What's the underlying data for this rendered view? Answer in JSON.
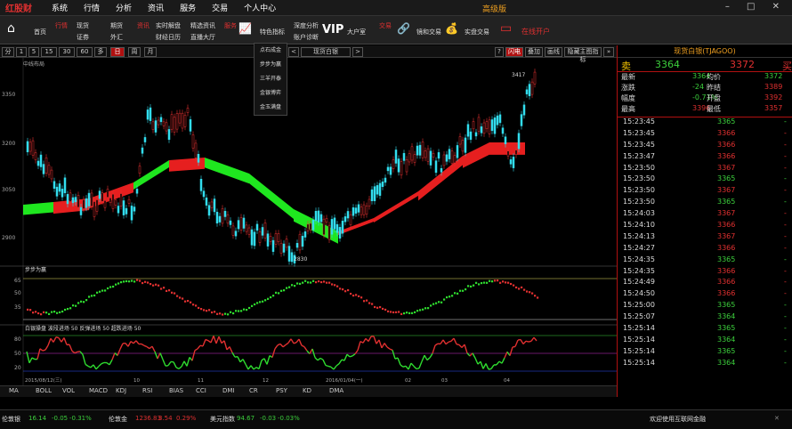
{
  "app": {
    "logo": "红股财",
    "title": "高级版"
  },
  "menu": [
    "系统",
    "行情",
    "分析",
    "资讯",
    "服务",
    "交易",
    "个人中心"
  ],
  "toolbar": {
    "home": "首页",
    "quote_btns": [
      "现货",
      "期货",
      "实时解盘",
      "精选资讯",
      "证券",
      "外汇",
      "财经日历",
      "直播大厅"
    ],
    "special": "特色指标",
    "deep": "深度分析",
    "account": "账户诊断",
    "vip": "VIP",
    "big": "大户室",
    "link": "镜和交易",
    "real": "实盘交易",
    "open": "在线开户",
    "left_tags": [
      "行情",
      "资讯",
      "服务",
      "交易"
    ]
  },
  "dropdown": [
    "点石成金",
    "步步为赢",
    "三羊开泰",
    "金银博弈",
    "金玉满盘"
  ],
  "tabs": {
    "periods": [
      "分",
      "1",
      "5",
      "15",
      "30",
      "60",
      "多",
      "日",
      "周",
      "月"
    ],
    "active": "日",
    "symbol": "现货白银",
    "right": [
      "?",
      "闪电",
      "叠加",
      "画线",
      "隐藏主图指标"
    ]
  },
  "chart": {
    "title": "中线布局",
    "ylabels": [
      "3350",
      "3200",
      "3050",
      "2900"
    ],
    "high_label": "3417",
    "low_label": "2830",
    "ind1_title": "步步为赢",
    "ind1_ylabels": [
      "65",
      "50",
      "35"
    ],
    "ind2_title": "白银操盘 波段进场 50 反弹进场 50 超跌进场 50",
    "ind2_ylabels": [
      "80",
      "50",
      "20"
    ],
    "xlabels": [
      "2015/08/12(三)",
      "10",
      "11",
      "12",
      "2016/01/04(一)",
      "02",
      "03",
      "04"
    ]
  },
  "indicators": [
    "MA",
    "BOLL",
    "VOL",
    "MACD",
    "KDJ",
    "RSI",
    "BIAS",
    "CCI",
    "DMI",
    "CR",
    "PSY",
    "KD",
    "DMA"
  ],
  "side": {
    "title": "现货白银(TJAGOO)",
    "sell_label": "卖",
    "sell_price": "3364",
    "buy_price": "3372",
    "buy_label": "买",
    "stats": [
      [
        "最新",
        "3364",
        "均价",
        "3372"
      ],
      [
        "涨跌",
        "-24",
        "昨结",
        "3389"
      ],
      [
        "幅度",
        "-0.71%",
        "开盘",
        "3392"
      ],
      [
        "最高",
        "3396",
        "最低",
        "3357"
      ]
    ],
    "trades": [
      [
        "15:23:45",
        "3365",
        "-"
      ],
      [
        "15:23:45",
        "3366",
        "-"
      ],
      [
        "15:23:45",
        "3366",
        "-"
      ],
      [
        "15:23:47",
        "3366",
        "-"
      ],
      [
        "15:23:50",
        "3367",
        "-"
      ],
      [
        "15:23:50",
        "3365",
        "-"
      ],
      [
        "15:23:50",
        "3367",
        "-"
      ],
      [
        "15:23:50",
        "3365",
        "-"
      ],
      [
        "15:24:03",
        "3367",
        "-"
      ],
      [
        "15:24:10",
        "3366",
        "-"
      ],
      [
        "15:24:13",
        "3367",
        "-"
      ],
      [
        "15:24:27",
        "3366",
        "-"
      ],
      [
        "15:24:35",
        "3365",
        "-"
      ],
      [
        "15:24:35",
        "3366",
        "-"
      ],
      [
        "15:24:49",
        "3366",
        "-"
      ],
      [
        "15:24:50",
        "3366",
        "-"
      ],
      [
        "15:25:00",
        "3365",
        "-"
      ],
      [
        "15:25:07",
        "3364",
        "-"
      ],
      [
        "15:25:14",
        "3365",
        "-"
      ],
      [
        "15:25:14",
        "3364",
        "-"
      ],
      [
        "15:25:14",
        "3365",
        "-"
      ],
      [
        "15:25:14",
        "3364",
        "-"
      ]
    ]
  },
  "status": {
    "items": [
      [
        "伦敦银",
        "16.14",
        "-0.05",
        "-0.31%"
      ],
      [
        "伦敦金",
        "1236.83",
        "3.54",
        "0.29%"
      ],
      [
        "美元指数",
        "94.67",
        "-0.03",
        "-0.03%"
      ]
    ],
    "welcome": "欢迎使用互联网金融"
  }
}
